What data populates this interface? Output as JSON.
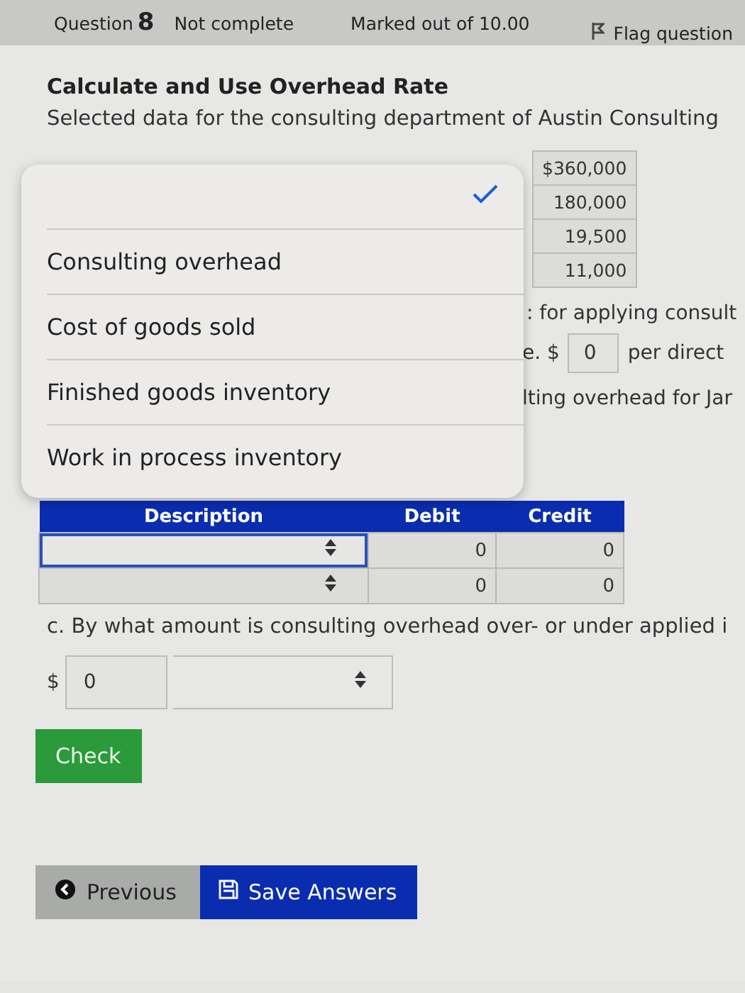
{
  "header": {
    "question_label": "Question",
    "question_number": "8",
    "status": "Not complete",
    "marks": "Marked out of 10.00",
    "flag": "Flag question"
  },
  "title": "Calculate and Use Overhead Rate",
  "intro": "Selected data for the consulting department of Austin Consulting",
  "data_values": [
    "$360,000",
    "180,000",
    "19,500",
    "11,000"
  ],
  "fragments": {
    "line_1": ": for applying consult",
    "rate_prefix": "e. $",
    "rate_value": "0",
    "rate_suffix": "per direct",
    "line_3": "lting overhead for Jar"
  },
  "journal": {
    "columns": [
      "Description",
      "Debit",
      "Credit"
    ],
    "rows": [
      {
        "focused": true,
        "debit": "0",
        "credit": "0"
      },
      {
        "focused": false,
        "debit": "0",
        "credit": "0"
      }
    ]
  },
  "question_c": "c. By what amount is consulting overhead over- or under applied i",
  "answer_c": {
    "prefix": "$",
    "value": "0"
  },
  "check_button": "Check",
  "nav": {
    "previous": "Previous",
    "save": "Save Answers"
  },
  "picker": {
    "options": [
      {
        "selected": true
      },
      {
        "label": "Consulting overhead",
        "selected": false
      },
      {
        "label": "Cost of goods sold",
        "selected": false
      },
      {
        "label": "Finished goods inventory",
        "selected": false
      },
      {
        "label": "Work in process inventory",
        "selected": false
      }
    ]
  }
}
